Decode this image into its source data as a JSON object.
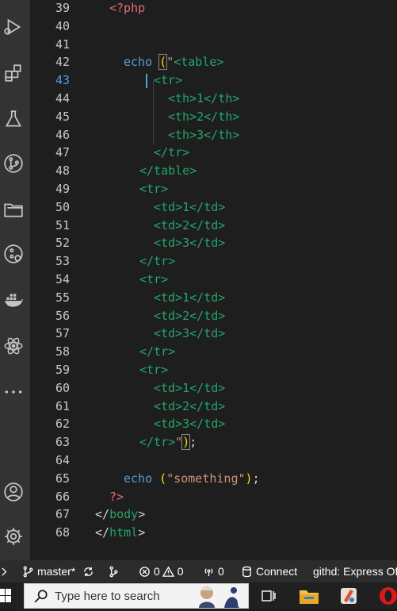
{
  "editor": {
    "active_line": 43,
    "lines": [
      {
        "n": "39",
        "tokens": [
          {
            "t": "<?php",
            "c": "k-red"
          }
        ]
      },
      {
        "n": "40",
        "tokens": []
      },
      {
        "n": "41",
        "tokens": []
      },
      {
        "n": "42",
        "tokens": [
          {
            "t": "echo",
            "c": "k-blue"
          },
          {
            "t": " ",
            "c": "k-white"
          },
          {
            "t": "(",
            "c": "k-yellow"
          },
          {
            "t": "\"",
            "c": "k-orange"
          },
          {
            "t": "<table>",
            "c": "k-green"
          }
        ]
      },
      {
        "n": "43",
        "tokens": [
          {
            "t": "<tr>",
            "c": "k-green"
          }
        ]
      },
      {
        "n": "44",
        "tokens": [
          {
            "t": "<th>1</th>",
            "c": "k-green"
          }
        ]
      },
      {
        "n": "45",
        "tokens": [
          {
            "t": "<th>2</th>",
            "c": "k-green"
          }
        ]
      },
      {
        "n": "46",
        "tokens": [
          {
            "t": "<th>3</th>",
            "c": "k-green"
          }
        ]
      },
      {
        "n": "47",
        "tokens": [
          {
            "t": "</tr>",
            "c": "k-green"
          }
        ]
      },
      {
        "n": "48",
        "tokens": [
          {
            "t": "</table>",
            "c": "k-green"
          }
        ]
      },
      {
        "n": "49",
        "tokens": [
          {
            "t": "<tr>",
            "c": "k-green"
          }
        ]
      },
      {
        "n": "50",
        "tokens": [
          {
            "t": "<td>1</td>",
            "c": "k-green"
          }
        ]
      },
      {
        "n": "51",
        "tokens": [
          {
            "t": "<td>2</td>",
            "c": "k-green"
          }
        ]
      },
      {
        "n": "52",
        "tokens": [
          {
            "t": "<td>3</td>",
            "c": "k-green"
          }
        ]
      },
      {
        "n": "53",
        "tokens": [
          {
            "t": "</tr>",
            "c": "k-green"
          }
        ]
      },
      {
        "n": "54",
        "tokens": [
          {
            "t": "<tr>",
            "c": "k-green"
          }
        ]
      },
      {
        "n": "55",
        "tokens": [
          {
            "t": "<td>1</td>",
            "c": "k-green"
          }
        ]
      },
      {
        "n": "56",
        "tokens": [
          {
            "t": "<td>2</td>",
            "c": "k-green"
          }
        ]
      },
      {
        "n": "57",
        "tokens": [
          {
            "t": "<td>3</td>",
            "c": "k-green"
          }
        ]
      },
      {
        "n": "58",
        "tokens": [
          {
            "t": "</tr>",
            "c": "k-green"
          }
        ]
      },
      {
        "n": "59",
        "tokens": [
          {
            "t": "<tr>",
            "c": "k-green"
          }
        ]
      },
      {
        "n": "60",
        "tokens": [
          {
            "t": "<td>1</td>",
            "c": "k-green"
          }
        ]
      },
      {
        "n": "61",
        "tokens": [
          {
            "t": "<td>2</td>",
            "c": "k-green"
          }
        ]
      },
      {
        "n": "62",
        "tokens": [
          {
            "t": "<td>3</td>",
            "c": "k-green"
          }
        ]
      },
      {
        "n": "63",
        "tokens": [
          {
            "t": "</tr>",
            "c": "k-green"
          },
          {
            "t": "\"",
            "c": "k-orange"
          },
          {
            "t": ")",
            "c": "k-yellow"
          },
          {
            "t": ";",
            "c": "k-white"
          }
        ]
      },
      {
        "n": "64",
        "tokens": []
      },
      {
        "n": "65",
        "tokens": [
          {
            "t": "echo",
            "c": "k-blue"
          },
          {
            "t": " ",
            "c": "k-white"
          },
          {
            "t": "(",
            "c": "k-yellow"
          },
          {
            "t": "\"something\"",
            "c": "k-orange"
          },
          {
            "t": ")",
            "c": "k-yellow"
          },
          {
            "t": ";",
            "c": "k-white"
          }
        ]
      },
      {
        "n": "66",
        "tokens": [
          {
            "t": "?>",
            "c": "k-red"
          }
        ]
      },
      {
        "n": "67",
        "tokens": [
          {
            "t": "</",
            "c": "k-white"
          },
          {
            "t": "body",
            "c": "k-green"
          },
          {
            "t": ">",
            "c": "k-white"
          }
        ]
      },
      {
        "n": "68",
        "tokens": [
          {
            "t": "</",
            "c": "k-white"
          },
          {
            "t": "html",
            "c": "k-green"
          },
          {
            "t": ">",
            "c": "k-white"
          }
        ]
      }
    ]
  },
  "activity_bar": {
    "icons": [
      "run-debug-icon",
      "extensions-icon",
      "testing-icon",
      "source-control-icon",
      "explorer-icon",
      "remote-explorer-icon",
      "docker-icon",
      "react-icon",
      "more-icon",
      "account-icon",
      "settings-icon"
    ]
  },
  "statusbar": {
    "branch": "master*",
    "errors": "0",
    "warnings": "0",
    "ports": "0",
    "connect": "Connect",
    "githd": "githd: Express Of"
  },
  "taskbar": {
    "search_placeholder": "Type here to search"
  }
}
